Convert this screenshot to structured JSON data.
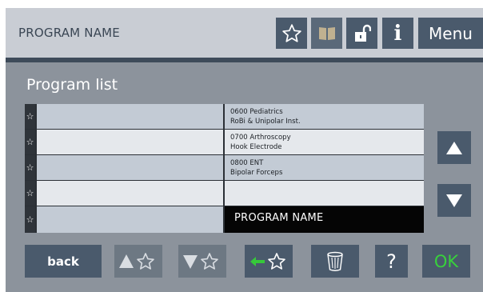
{
  "header": {
    "title": "PROGRAM NAME",
    "buttons": {
      "favorite_icon": "star-outline-icon",
      "book_icon": "book-icon",
      "lock_icon": "unlocked-padlock-icon",
      "info_label": "i",
      "menu_label": "Menu"
    }
  },
  "program_list": {
    "title": "Program list",
    "rows": [
      {
        "star": "☆",
        "col1": "",
        "line1": "0600 Pediatrics",
        "line2": "RoBi & Unipolar Inst.",
        "selected": false
      },
      {
        "star": "☆",
        "col1": "",
        "line1": "0700 Arthroscopy",
        "line2": "Hook Electrode",
        "selected": false
      },
      {
        "star": "☆",
        "col1": "",
        "line1": "0800 ENT",
        "line2": "Bipolar Forceps",
        "selected": false
      },
      {
        "star": "☆",
        "col1": "",
        "line1": "",
        "line2": "",
        "selected": false
      },
      {
        "star": "☆",
        "col1": "",
        "line1": "PROGRAM NAME",
        "line2": "",
        "selected": true
      }
    ]
  },
  "scroll": {
    "up_icon": "triangle-up-icon",
    "down_icon": "triangle-down-icon"
  },
  "bottom_bar": {
    "back_label": "back",
    "move_up_favorite_icon": "triangle-up-star-icon",
    "move_down_favorite_icon": "triangle-down-star-icon",
    "add_favorite_icon": "arrow-left-star-icon",
    "delete_icon": "trash-icon",
    "help_label": "?",
    "ok_label": "OK"
  },
  "colors": {
    "header_bg": "#c9cdd4",
    "button_dark": "#4a5a6c",
    "button_disabled": "#6d7883",
    "content_bg": "#8c939c",
    "row_light": "#e5e8ec",
    "row_mid": "#c3cbd5",
    "selected_bg": "#050505",
    "ok_green": "#38d13c",
    "arrow_green": "#36c93a"
  }
}
